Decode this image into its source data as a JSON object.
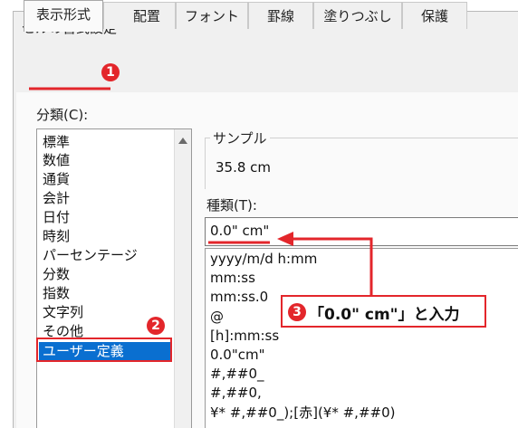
{
  "dialog": {
    "title": "セルの書式設定"
  },
  "tabs": [
    {
      "label": "表示形式"
    },
    {
      "label": "配置"
    },
    {
      "label": "フォント"
    },
    {
      "label": "罫線"
    },
    {
      "label": "塗りつぶし"
    },
    {
      "label": "保護"
    }
  ],
  "category": {
    "label": "分類(C):",
    "items": [
      "標準",
      "数値",
      "通貨",
      "会計",
      "日付",
      "時刻",
      "パーセンテージ",
      "分数",
      "指数",
      "文字列",
      "その他",
      "ユーザー定義"
    ],
    "selected": "ユーザー定義"
  },
  "sample": {
    "label": "サンプル",
    "value": "35.8 cm"
  },
  "type_field": {
    "label": "種類(T):",
    "value": "0.0\" cm\""
  },
  "format_list": [
    "yyyy/m/d h:mm",
    "mm:ss",
    "mm:ss.0",
    "@",
    "[h]:mm:ss",
    "0.0\"cm\"",
    "#,##0_",
    "#,##0,",
    "¥* #,##0_);[赤](¥* #,##0)"
  ],
  "annotations": {
    "badge1": "1",
    "badge2": "2",
    "badge3": "3",
    "callout_text": "「0.0\" cm\"」と入力"
  },
  "colors": {
    "accent_red": "#e3262b",
    "selection_blue": "#0a6fd0"
  }
}
